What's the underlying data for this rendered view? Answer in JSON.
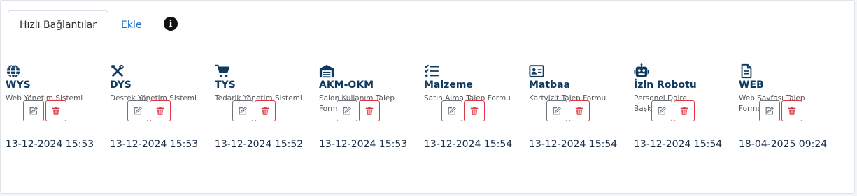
{
  "tabs": {
    "active": "Hızlı Bağlantılar",
    "add": "Ekle"
  },
  "colors": {
    "title": "#0e3a5f",
    "link": "#1f6fd1",
    "danger": "#dc3545"
  },
  "cards": [
    {
      "icon": "globe-icon",
      "title": "WYS",
      "desc": "Web Yönetim Sistemi",
      "date": "13-12-2024 15:53"
    },
    {
      "icon": "tools-icon",
      "title": "DYS",
      "desc": "Destek Yönetim Sistemi",
      "date": "13-12-2024 15:53"
    },
    {
      "icon": "cart-icon",
      "title": "TYS",
      "desc": "Tedarik Yönetim Sistemi",
      "date": "13-12-2024 15:52"
    },
    {
      "icon": "warehouse-icon",
      "title": "AKM-OKM",
      "desc": "Salon Kullanım Talep Formu",
      "date": "13-12-2024 15:53"
    },
    {
      "icon": "checklist-icon",
      "title": "Malzeme",
      "desc": "Satın Alma Talep Formu",
      "date": "13-12-2024 15:54"
    },
    {
      "icon": "id-card-icon",
      "title": "Matbaa",
      "desc": "Kartvizit Talep Formu",
      "date": "13-12-2024 15:54"
    },
    {
      "icon": "robot-icon",
      "title": "İzin Robotu",
      "desc": "Personel Daire Başkanlığı",
      "date": "13-12-2024 15:54"
    },
    {
      "icon": "document-icon",
      "title": "WEB",
      "desc": "Web Sayfası Talep Formu",
      "date": "18-04-2025 09:24"
    }
  ]
}
